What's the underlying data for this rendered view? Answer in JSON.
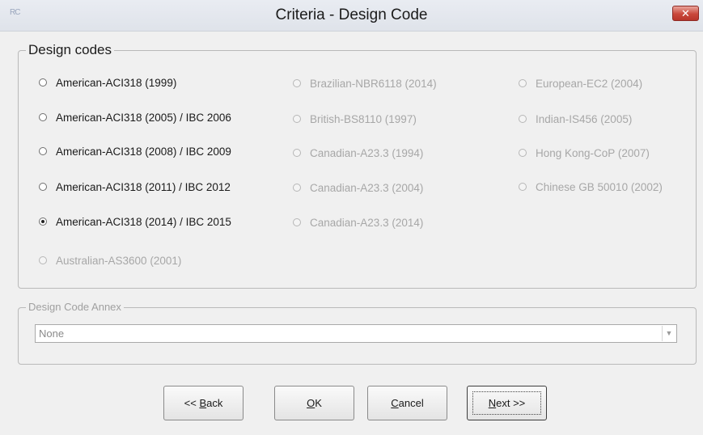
{
  "window": {
    "title": "Criteria - Design Code",
    "app_icon": "RC",
    "close_label": "✕"
  },
  "design_codes": {
    "legend": "Design codes",
    "options": [
      {
        "label": "American-ACI318 (1999)",
        "enabled": true,
        "checked": false
      },
      {
        "label": "American-ACI318 (2005) / IBC 2006",
        "enabled": true,
        "checked": false
      },
      {
        "label": "American-ACI318 (2008) / IBC 2009",
        "enabled": true,
        "checked": false
      },
      {
        "label": "American-ACI318 (2011) / IBC 2012",
        "enabled": true,
        "checked": false
      },
      {
        "label": "American-ACI318 (2014) / IBC 2015",
        "enabled": true,
        "checked": true
      },
      {
        "label": "Australian-AS3600 (2001)",
        "enabled": false,
        "checked": false
      },
      {
        "label": "Brazilian-NBR6118 (2014)",
        "enabled": false,
        "checked": false
      },
      {
        "label": "British-BS8110 (1997)",
        "enabled": false,
        "checked": false
      },
      {
        "label": "Canadian-A23.3 (1994)",
        "enabled": false,
        "checked": false
      },
      {
        "label": "Canadian-A23.3 (2004)",
        "enabled": false,
        "checked": false
      },
      {
        "label": "Canadian-A23.3 (2014)",
        "enabled": false,
        "checked": false
      },
      {
        "label": "European-EC2 (2004)",
        "enabled": false,
        "checked": false
      },
      {
        "label": "Indian-IS456 (2005)",
        "enabled": false,
        "checked": false
      },
      {
        "label": "Hong Kong-CoP (2007)",
        "enabled": false,
        "checked": false
      },
      {
        "label": "Chinese GB 50010 (2002)",
        "enabled": false,
        "checked": false
      }
    ]
  },
  "annex": {
    "legend": "Design Code Annex",
    "selected_value": "None",
    "enabled": false
  },
  "buttons": {
    "back": {
      "prefix": "<< ",
      "mnemonic": "B",
      "rest": "ack"
    },
    "ok": {
      "prefix": "",
      "mnemonic": "O",
      "rest": "K"
    },
    "cancel": {
      "prefix": "",
      "mnemonic": "C",
      "rest": "ancel"
    },
    "next": {
      "prefix": "",
      "mnemonic": "N",
      "rest": "ext >>"
    }
  },
  "colors": {
    "close_button": "#c9483b",
    "disabled_text": "#a7a7a7",
    "background": "#f0f0f0"
  }
}
